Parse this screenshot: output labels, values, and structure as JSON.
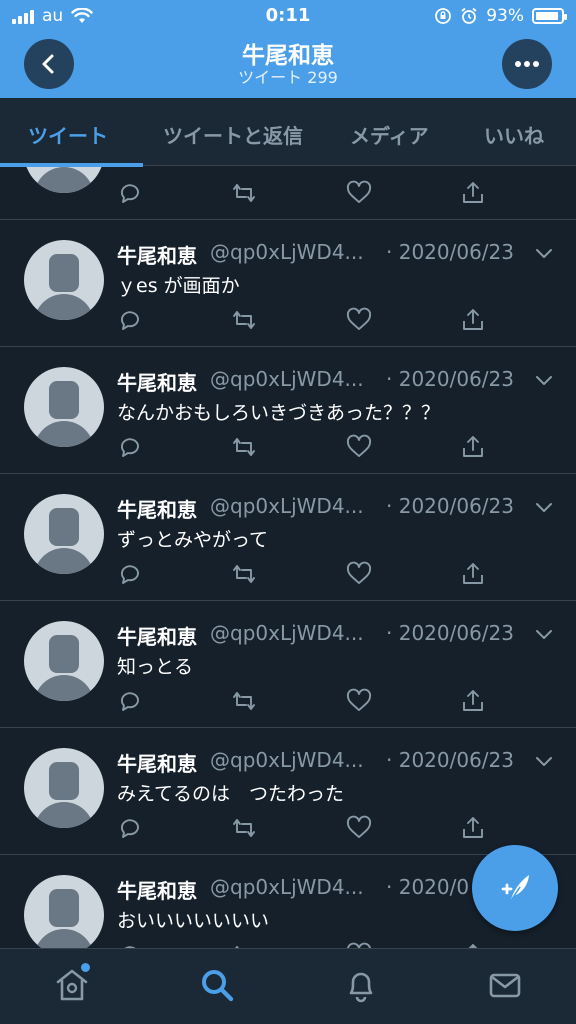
{
  "status_bar": {
    "carrier": "au",
    "time": "0:11",
    "battery": "93%",
    "battery_level": 0.93
  },
  "header": {
    "title": "牛尾和恵",
    "subtitle": "ツイート 299",
    "back_icon": "chevron-left-icon",
    "more_icon": "more-horizontal-icon"
  },
  "tabs": [
    {
      "label": "ツイート",
      "active": true
    },
    {
      "label": "ツイートと返信",
      "active": false
    },
    {
      "label": "メディア",
      "active": false
    },
    {
      "label": "いいね",
      "active": false
    }
  ],
  "tweets": [
    {
      "name": "",
      "handle": "",
      "date": "",
      "text": ""
    },
    {
      "name": "牛尾和恵",
      "handle": "@qp0xLjWD4...",
      "date": "· 2020/06/23",
      "text": "ｙes が画面か"
    },
    {
      "name": "牛尾和恵",
      "handle": "@qp0xLjWD4...",
      "date": "· 2020/06/23",
      "text": "なんかおもしろいきづきあった？？？"
    },
    {
      "name": "牛尾和恵",
      "handle": "@qp0xLjWD4...",
      "date": "· 2020/06/23",
      "text": "ずっとみやがって"
    },
    {
      "name": "牛尾和恵",
      "handle": "@qp0xLjWD4...",
      "date": "· 2020/06/23",
      "text": "知っとる"
    },
    {
      "name": "牛尾和恵",
      "handle": "@qp0xLjWD4...",
      "date": "· 2020/06/23",
      "text": "みえてるのは　つたわった"
    },
    {
      "name": "牛尾和恵",
      "handle": "@qp0xLjWD4...",
      "date": "· 2020/0",
      "text": "おいいいいいいい"
    }
  ],
  "bottom_nav": [
    "home-icon",
    "search-icon",
    "bell-icon",
    "mail-icon"
  ],
  "colors": {
    "accent": "#4a9fe8",
    "background": "#15202b",
    "secondary_text": "#8899a6"
  }
}
